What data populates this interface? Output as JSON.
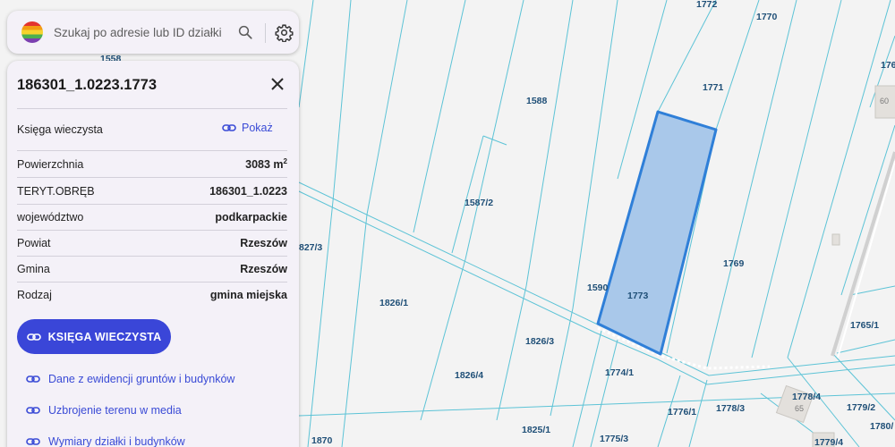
{
  "search": {
    "placeholder": "Szukaj po adresie lub ID działki ..."
  },
  "panel": {
    "title": "186301_1.0223.1773",
    "kw_label": "Księga wieczysta",
    "kw_show": "Pokaż",
    "rows": [
      {
        "label": "Powierzchnia",
        "value": "3083 m",
        "sup": "2"
      },
      {
        "label": "TERYT.OBRĘB",
        "value": "186301_1.0223"
      },
      {
        "label": "województwo",
        "value": "podkarpackie"
      },
      {
        "label": "Powiat",
        "value": "Rzeszów"
      },
      {
        "label": "Gmina",
        "value": "Rzeszów"
      },
      {
        "label": "Rodzaj",
        "value": "gmina miejska"
      }
    ],
    "kw_button": "KSIĘGA WIECZYSTA",
    "links": [
      "Dane z ewidencji gruntów i budynków",
      "Uzbrojenie terenu w media",
      "Wymiary działki i budynków"
    ]
  },
  "map": {
    "colors": {
      "parcel_line": "#5cc3d6",
      "selection_fill": "#a9c8ea",
      "selection_stroke": "#2f7fd8",
      "label": "#1f4f77"
    },
    "parcel_labels": [
      "1772",
      "1770",
      "176",
      "1558",
      "1588",
      "1771",
      "60",
      "1587/2",
      "827/3",
      "1769",
      "1590",
      "1773",
      "1765/1",
      "1826/1",
      "1826/3",
      "1826/4",
      "1774/1",
      "1778/4",
      "65",
      "1776/1",
      "1778/3",
      "1779/2",
      "1870",
      "1825/1",
      "1775/3",
      "1780/",
      "1779/4"
    ]
  }
}
